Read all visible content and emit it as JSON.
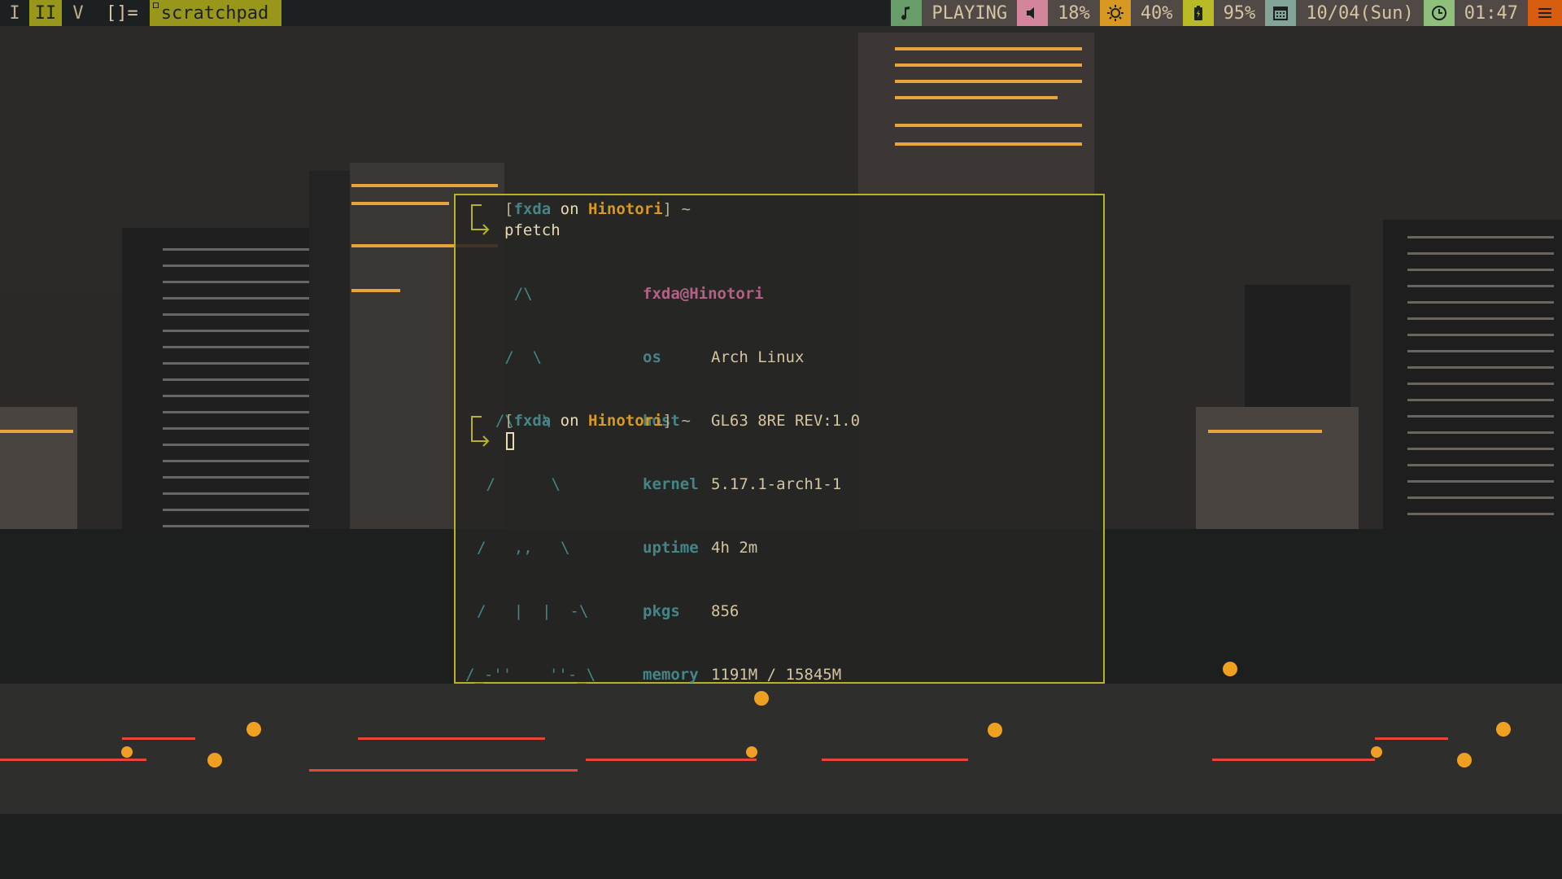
{
  "bar": {
    "tags": [
      "I",
      "II",
      "V"
    ],
    "layout": "[]=",
    "window_title": "scratchpad",
    "music": {
      "icon": "music-note-icon",
      "value": "PLAYING"
    },
    "volume": {
      "icon": "speaker-icon",
      "value": "18%"
    },
    "brightness": {
      "icon": "sun-icon",
      "value": "40%"
    },
    "battery": {
      "icon": "battery-icon",
      "value": "95%"
    },
    "date": {
      "icon": "calendar-icon",
      "value": "10/04(Sun)"
    },
    "time": {
      "icon": "clock-icon",
      "value": "01:47"
    },
    "menu": {
      "icon": "menu-icon"
    },
    "colors": {
      "bar_bg": "#1d2021",
      "active_tag": "#98971a",
      "music": "#689d6a",
      "volume": "#d3869b",
      "brightness": "#d79921",
      "battery": "#b8bb26",
      "date": "#83a598",
      "time": "#8ec07c",
      "menu": "#d65d0e"
    }
  },
  "terminal": {
    "prompt": {
      "open": "[",
      "user": "fxda",
      "on": "on",
      "host": "Hinotori",
      "close": "]",
      "dir": "~"
    },
    "command": "pfetch",
    "logo": [
      "    /\\",
      "   /  \\",
      "  /\\   \\",
      " /      \\",
      "/   ,,   \\",
      "/   |  |  -\\",
      "/_-''    ''-_\\"
    ],
    "user_host": {
      "user": "fxda",
      "at": "@",
      "host": "Hinotori"
    },
    "info": [
      {
        "key": "os",
        "value": "Arch Linux"
      },
      {
        "key": "host",
        "value": "GL63 8RE REV:1.0"
      },
      {
        "key": "kernel",
        "value": "5.17.1-arch1-1"
      },
      {
        "key": "uptime",
        "value": "4h 2m"
      },
      {
        "key": "pkgs",
        "value": "856"
      },
      {
        "key": "memory",
        "value": "1191M / 15845M"
      }
    ],
    "colors": {
      "border": "#b8b22a",
      "user": "#458588",
      "host": "#d79921",
      "label": "#458588",
      "uh": "#b16286"
    }
  }
}
